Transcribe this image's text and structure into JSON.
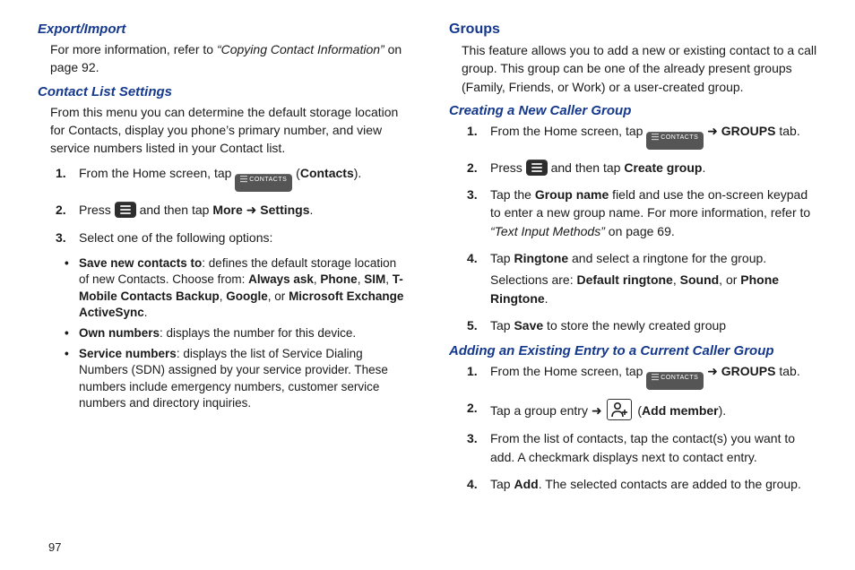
{
  "labels": {
    "contacts_btn": "CONTACTS"
  },
  "left": {
    "h_export": "Export/Import",
    "export_p_pre": "For more information, refer to ",
    "export_ref": "“Copying Contact Information”",
    "export_p_post": "  on page 92.",
    "h_cls": "Contact List Settings",
    "cls_p": "From this menu you can determine the default storage location for Contacts, display you phone’s primary number, and view service numbers listed in your Contact list.",
    "s1_pre": "From the Home screen, tap  ",
    "s1_post_a": "  (",
    "s1_contacts": "Contacts",
    "s1_post_b": ").",
    "s2_pre": "Press  ",
    "s2_mid": "  and then tap ",
    "s2_more": "More",
    "s2_arrow": " ➜ ",
    "s2_settings": "Settings",
    "s2_end": ".",
    "s3": "Select one of the following options:",
    "b1_lead": "Save new contacts to",
    "b1_rest": ": defines the default storage location of new Contacts. Choose from: ",
    "b1_aa": "Always ask",
    "b1_c1": ", ",
    "b1_ph": "Phone",
    "b1_c2": ", ",
    "b1_sim": "SIM",
    "b1_c3": ", ",
    "b1_tmo": "T-Mobile Contacts Backup",
    "b1_c4": ", ",
    "b1_g": "Google",
    "b1_c5": ", or ",
    "b1_ms": "Microsoft Exchange ActiveSync",
    "b1_c6": ".",
    "b2_lead": "Own numbers",
    "b2_rest": ": displays the number for this device.",
    "b3_lead": "Service numbers",
    "b3_rest": ": displays the list of Service Dialing Numbers (SDN) assigned by your service provider. These numbers include emergency numbers, customer service numbers and directory inquiries."
  },
  "right": {
    "h_groups": "Groups",
    "groups_p": "This feature allows you to add a new or existing contact to a call group. This group can be one of the already present groups (Family, Friends, or Work) or a user-created group.",
    "h_cncg": "Creating a New Caller Group",
    "c1_pre": "From the Home screen, tap  ",
    "c1_arrow": "  ➜ ",
    "c1_groups": "GROUPS",
    "c1_post": " tab.",
    "c2_pre": "Press  ",
    "c2_mid": "  and then tap ",
    "c2_cg": "Create group",
    "c2_end": ".",
    "c3_pre": "Tap the ",
    "c3_gname": "Group name",
    "c3_mid": " field and use the on-screen keypad to enter a new group name. For more information, refer to ",
    "c3_ref": "“Text Input Methods”",
    "c3_post": "  on page 69.",
    "c4_pre": "Tap ",
    "c4_ring": "Ringtone",
    "c4_mid": " and select a ringtone for the group.",
    "c4_sel_pre": "Selections are: ",
    "c4_dr": "Default ringtone",
    "c4_c1": ", ",
    "c4_s": "Sound",
    "c4_c2": ", or ",
    "c4_pr": "Phone Ringtone",
    "c4_c3": ".",
    "c5_pre": "Tap ",
    "c5_save": "Save",
    "c5_post": " to store the newly created group",
    "h_aee": "Adding an Existing Entry to a Current Caller Group",
    "a1_pre": "From the Home screen, tap  ",
    "a1_arrow": "  ➜ ",
    "a1_groups": "GROUPS",
    "a1_post": " tab.",
    "a2_pre": "Tap a group entry ➜ ",
    "a2_open": " (",
    "a2_am": "Add member",
    "a2_close": ").",
    "a3": "From the list of contacts, tap the contact(s) you want to add. A checkmark displays next to contact entry.",
    "a4_pre": "Tap ",
    "a4_add": "Add",
    "a4_post": ". The selected contacts are added to the group."
  },
  "pagenum": "97"
}
